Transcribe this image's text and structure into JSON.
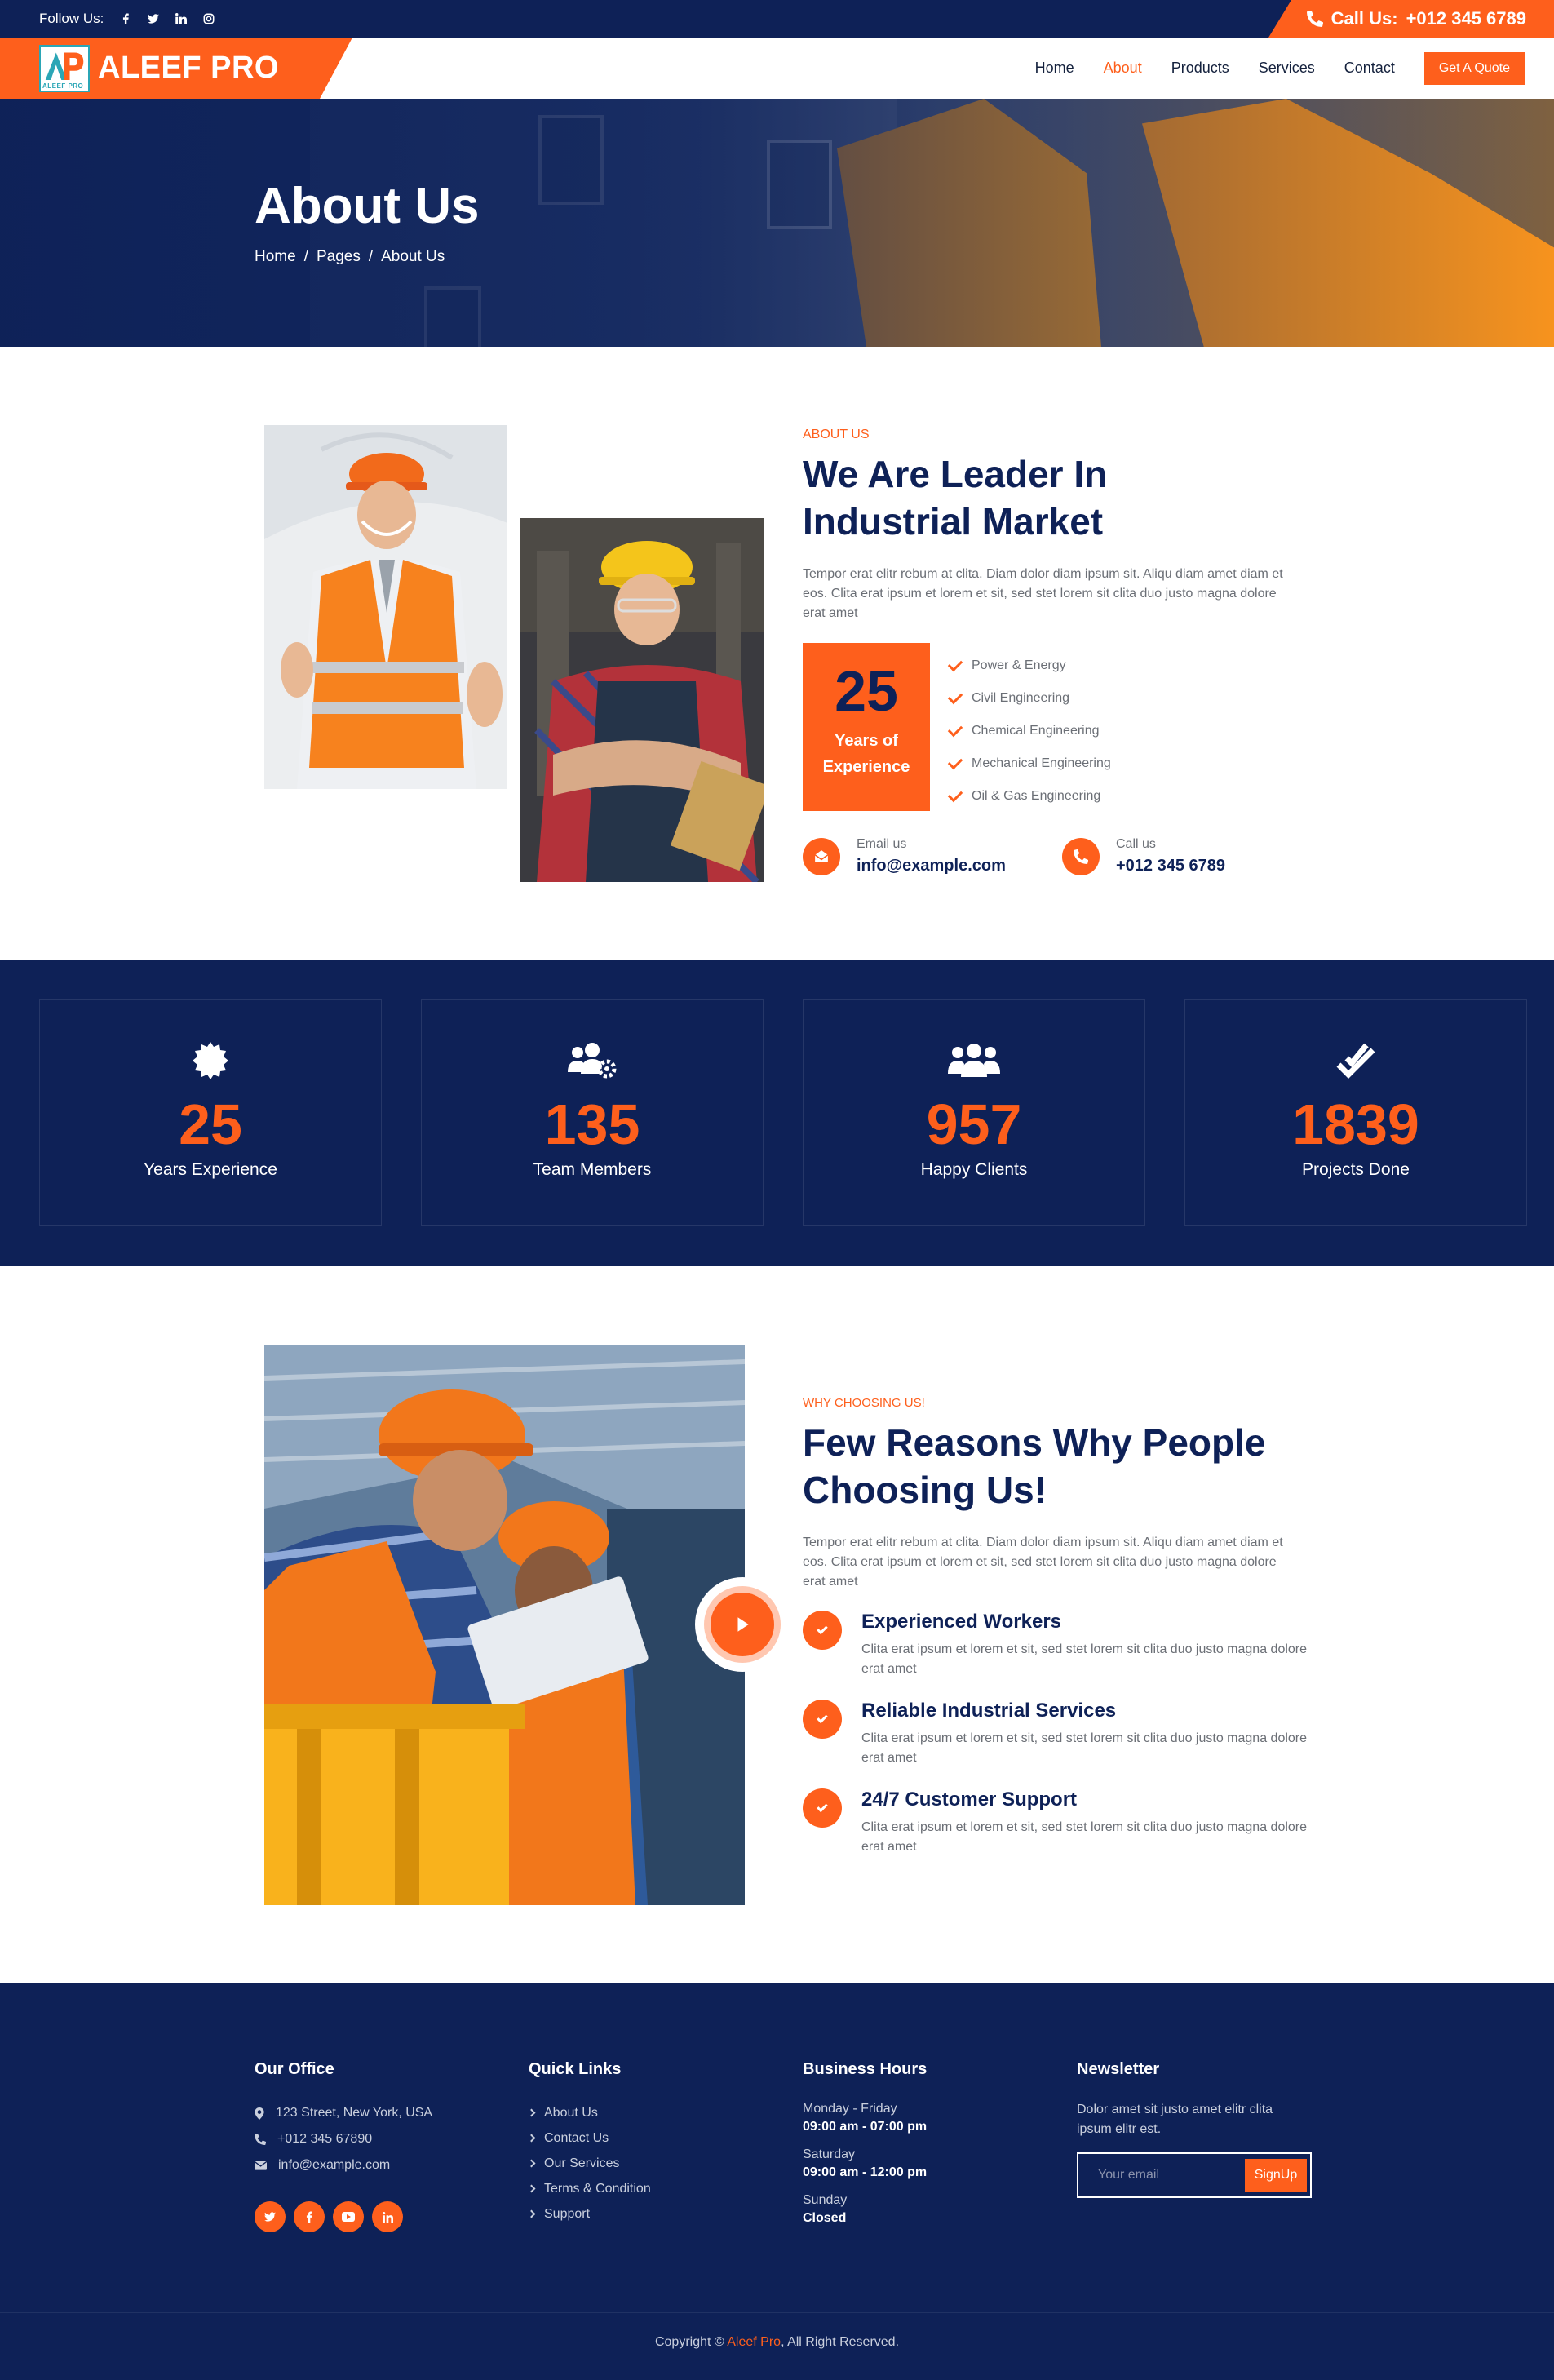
{
  "topbar": {
    "follow_label": "Follow Us:",
    "social_icons": [
      "facebook-icon",
      "twitter-icon",
      "linkedin-icon",
      "instagram-icon"
    ],
    "call_label": "Call Us:",
    "call_number": "+012 345 6789"
  },
  "navbar": {
    "logo_text": "ALEEF PRO",
    "logo_mark_text": "ALEEF PRO",
    "items": [
      {
        "label": "Home",
        "active": false
      },
      {
        "label": "About",
        "active": true
      },
      {
        "label": "Products",
        "active": false
      },
      {
        "label": "Services",
        "active": false
      },
      {
        "label": "Contact",
        "active": false
      }
    ],
    "quote_label": "Get A Quote"
  },
  "banner": {
    "title": "About Us",
    "breadcrumb": [
      "Home",
      "/",
      "Pages",
      "/",
      "About Us"
    ]
  },
  "about": {
    "sub_label": "ABOUT US",
    "title_line1": "We Are Leader In",
    "title_line2": "Industrial Market",
    "paragraph": "Tempor erat elitr rebum at clita. Diam dolor diam ipsum sit. Aliqu diam amet diam et eos. Clita erat ipsum et lorem et sit, sed stet lorem sit clita duo justo magna dolore erat amet",
    "experience_number": "25",
    "experience_line1": "Years of",
    "experience_line2": "Experience",
    "checklist": [
      "Power & Energy",
      "Civil Engineering",
      "Chemical Engineering",
      "Mechanical Engineering",
      "Oil & Gas Engineering"
    ],
    "email_label": "Email us",
    "email_value": "info@example.com",
    "call_label": "Call us",
    "call_value": "+012 345 6789"
  },
  "stats": [
    {
      "icon": "certificate-icon",
      "number": "25",
      "label": "Years Experience"
    },
    {
      "icon": "users-cog-icon",
      "number": "135",
      "label": "Team Members"
    },
    {
      "icon": "users-icon",
      "number": "957",
      "label": "Happy Clients"
    },
    {
      "icon": "check-double-icon",
      "number": "1839",
      "label": "Projects Done"
    }
  ],
  "why": {
    "sub_label": "WHY CHOOSING US!",
    "title_line1": "Few Reasons Why People",
    "title_line2": "Choosing Us!",
    "paragraph": "Tempor erat elitr rebum at clita. Diam dolor diam ipsum sit. Aliqu diam amet diam et eos. Clita erat ipsum et lorem et sit, sed stet lorem sit clita duo justo magna dolore erat amet",
    "features": [
      {
        "title": "Experienced Workers",
        "desc": "Clita erat ipsum et lorem et sit, sed stet lorem sit clita duo justo magna dolore erat amet"
      },
      {
        "title": "Reliable Industrial Services",
        "desc": "Clita erat ipsum et lorem et sit, sed stet lorem sit clita duo justo magna dolore erat amet"
      },
      {
        "title": "24/7 Customer Support",
        "desc": "Clita erat ipsum et lorem et sit, sed stet lorem sit clita duo justo magna dolore erat amet"
      }
    ]
  },
  "footer": {
    "office_title": "Our Office",
    "address": "123 Street, New York, USA",
    "phone": "+012 345 67890",
    "email": "info@example.com",
    "social_icons": [
      "twitter-icon",
      "facebook-icon",
      "youtube-icon",
      "linkedin-icon"
    ],
    "links_title": "Quick Links",
    "links": [
      "About Us",
      "Contact Us",
      "Our Services",
      "Terms & Condition",
      "Support"
    ],
    "hours_title": "Business Hours",
    "hours": [
      {
        "day": "Monday - Friday",
        "time": "09:00 am - 07:00 pm"
      },
      {
        "day": "Saturday",
        "time": "09:00 am - 12:00 pm"
      },
      {
        "day": "Sunday",
        "time": "Closed"
      }
    ],
    "newsletter_title": "Newsletter",
    "newsletter_text": "Dolor amet sit justo amet elitr clita ipsum elitr est.",
    "newsletter_placeholder": "Your email",
    "newsletter_button": "SignUp",
    "copyright_prefix": "Copyright © ",
    "copyright_brand": "Aleef Pro",
    "copyright_suffix": ", All Right Reserved."
  },
  "colors": {
    "navy": "#0e2157",
    "orange": "#fe5f1c"
  }
}
